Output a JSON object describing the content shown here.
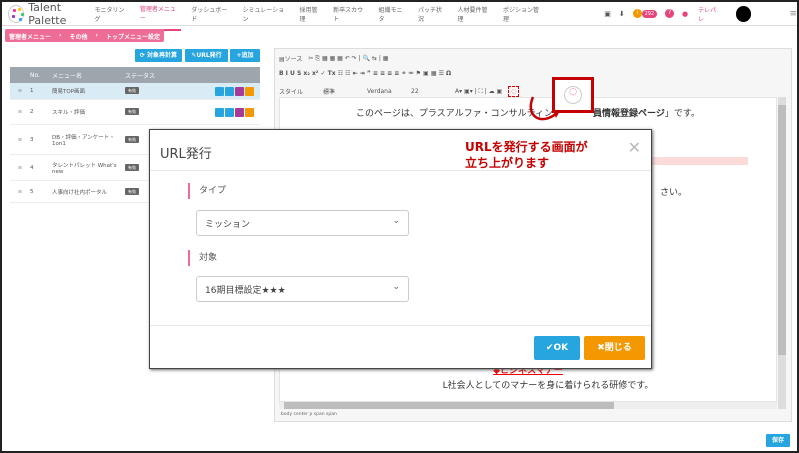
{
  "app": {
    "logo_text": "Talent Palette"
  },
  "nav": {
    "items": [
      "モニタリング",
      "管理者メニュー",
      "ダッシュボード",
      "シミュレーション",
      "採用管理",
      "新卒スカウト",
      "組織モニタ",
      "パッチ状況",
      "人材要件管理",
      "ポジション管理"
    ],
    "badge_count": "292",
    "telepale": "テレパレ"
  },
  "breadcrumb": [
    "管理者メニュー",
    "その他",
    "トップメニュー設定"
  ],
  "toolbar": {
    "recalc": "対象再計算",
    "url_issue": "URL発行",
    "add": "追加"
  },
  "table": {
    "headers": [
      "No.",
      "メニュー名",
      "ステータス"
    ],
    "rows": [
      {
        "no": "1",
        "name": "簡易TOP画面",
        "status": "有効"
      },
      {
        "no": "2",
        "name": "スキル・評価",
        "status": "有効"
      },
      {
        "no": "3",
        "name": "DB・評価・アンケート・1on1",
        "status": "有効"
      },
      {
        "no": "4",
        "name": "タレントパレット What's new",
        "status": "有効"
      },
      {
        "no": "5",
        "name": "人事向け社内ポータル",
        "status": "有効"
      }
    ]
  },
  "editor": {
    "source": "ソース",
    "style": "スタイル",
    "format": "標準",
    "font": "Verdana",
    "size": "22",
    "line1": "このページは、プラスアルファ・コンサルティン",
    "line1_bold": "員情報登録ページ",
    "line1_end": "」です。",
    "line2": "さい。",
    "link": "◆ビジネスマナー",
    "line3": "L社会人としてのマナーを身に着けられる研修です。",
    "path": "body  center  p  span  span"
  },
  "modal": {
    "title": "URL発行",
    "type_label": "タイプ",
    "type_value": "ミッション",
    "target_label": "対象",
    "target_value": "16期目標設定★★★",
    "ok": "OK",
    "close": "閉じる"
  },
  "annotation": {
    "line1": "URLを発行する画面が",
    "line2": "立ち上がります"
  },
  "save": "保存"
}
